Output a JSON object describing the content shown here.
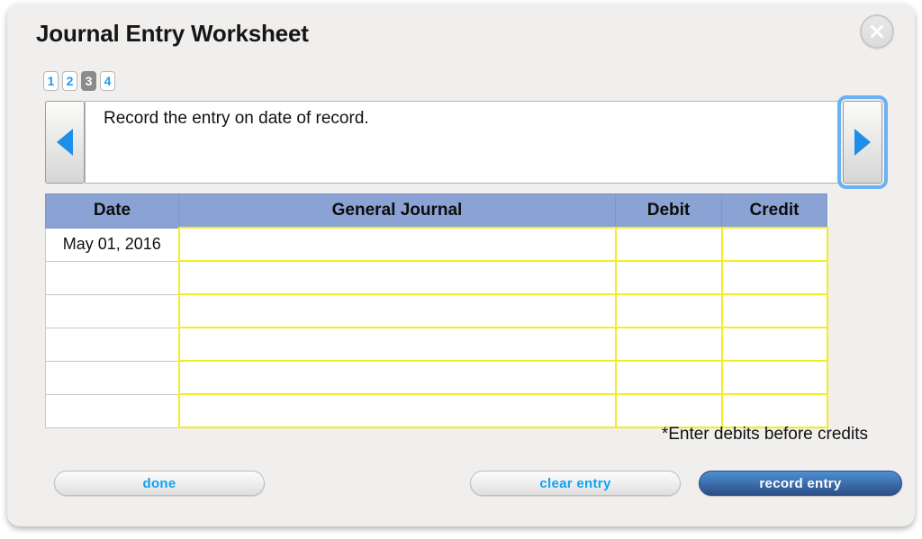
{
  "window": {
    "title": "Journal Entry Worksheet",
    "close_icon": "close-x-icon"
  },
  "pager": {
    "pages": [
      "1",
      "2",
      "3",
      "4"
    ],
    "active_index": 2
  },
  "navigator": {
    "prev_icon": "triangle-left-icon",
    "next_icon": "triangle-right-icon",
    "instruction": "Record the entry on date of record."
  },
  "table": {
    "headers": [
      "Date",
      "General Journal",
      "Debit",
      "Credit"
    ],
    "rows": [
      {
        "date": "May 01, 2016",
        "journal": "",
        "debit": "",
        "credit": ""
      },
      {
        "date": "",
        "journal": "",
        "debit": "",
        "credit": ""
      },
      {
        "date": "",
        "journal": "",
        "debit": "",
        "credit": ""
      },
      {
        "date": "",
        "journal": "",
        "debit": "",
        "credit": ""
      },
      {
        "date": "",
        "journal": "",
        "debit": "",
        "credit": ""
      },
      {
        "date": "",
        "journal": "",
        "debit": "",
        "credit": ""
      }
    ],
    "footnote": "*Enter debits before credits"
  },
  "footer": {
    "done_label": "done",
    "clear_label": "clear entry",
    "record_label": "record entry"
  },
  "colors": {
    "header_blue": "#8aa2d4",
    "cell_border_yellow": "#f5ec28",
    "link_blue": "#0fa2f7",
    "arrow_blue": "#1e8fe8",
    "focus_ring": "#6cb0f5",
    "panel_bg": "#f0efed",
    "active_tab_gray": "#8b8b8b"
  }
}
